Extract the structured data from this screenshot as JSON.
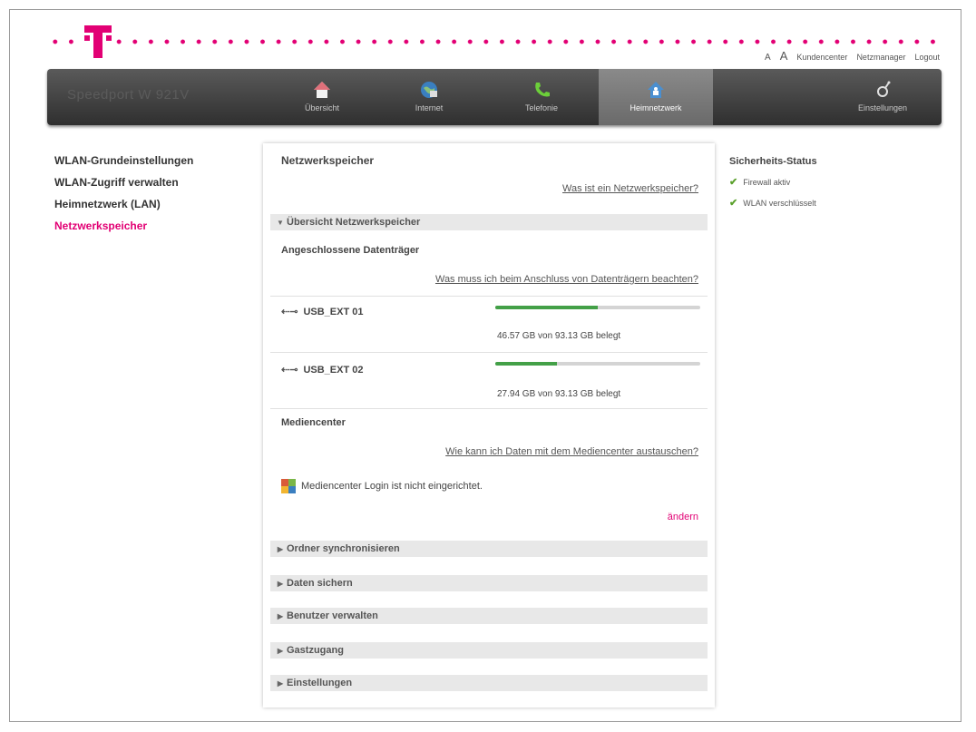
{
  "header": {
    "font_small": "A",
    "font_large": "A",
    "links": [
      "Kundencenter",
      "Netzmanager",
      "Logout"
    ]
  },
  "nav": {
    "device_name": "Speedport W 921V",
    "items": [
      {
        "label": "Übersicht",
        "icon": "home-icon"
      },
      {
        "label": "Internet",
        "icon": "globe-icon"
      },
      {
        "label": "Telefonie",
        "icon": "phone-icon"
      },
      {
        "label": "Heimnetzwerk",
        "icon": "home-network-icon",
        "active": true
      },
      {
        "label": "Einstellungen",
        "icon": "settings-icon"
      }
    ]
  },
  "sidebar": {
    "items": [
      {
        "label": "WLAN-Grundeinstellungen"
      },
      {
        "label": "WLAN-Zugriff verwalten"
      },
      {
        "label": "Heimnetzwerk (LAN)"
      },
      {
        "label": "Netzwerkspeicher",
        "active": true
      }
    ]
  },
  "main": {
    "title": "Netzwerkspeicher",
    "help_link": "Was ist ein Netzwerkspeicher?",
    "overview_header": "Übersicht Netzwerkspeicher",
    "connected_title": "Angeschlossene Datenträger",
    "connected_link": "Was muss ich beim Anschluss von Datenträgern beachten?",
    "devices": [
      {
        "name": "USB_EXT 01",
        "usage": "46.57 GB von 93.13 GB belegt",
        "fill": 0.5
      },
      {
        "name": "USB_EXT 02",
        "usage": "27.94 GB von 93.13 GB belegt",
        "fill": 0.3
      }
    ],
    "media_title": "Mediencenter",
    "media_link": "Wie kann ich Daten mit dem Mediencenter austauschen?",
    "media_status": "Mediencenter Login ist nicht eingerichtet.",
    "change_label": "ändern",
    "sections": [
      "Ordner synchronisieren",
      "Daten sichern",
      "Benutzer verwalten",
      "Gastzugang",
      "Einstellungen"
    ]
  },
  "security": {
    "title": "Sicherheits-Status",
    "items": [
      "Firewall aktiv",
      "WLAN verschlüsselt"
    ]
  },
  "colors": {
    "accent": "#e20074",
    "progress": "#43a047"
  }
}
